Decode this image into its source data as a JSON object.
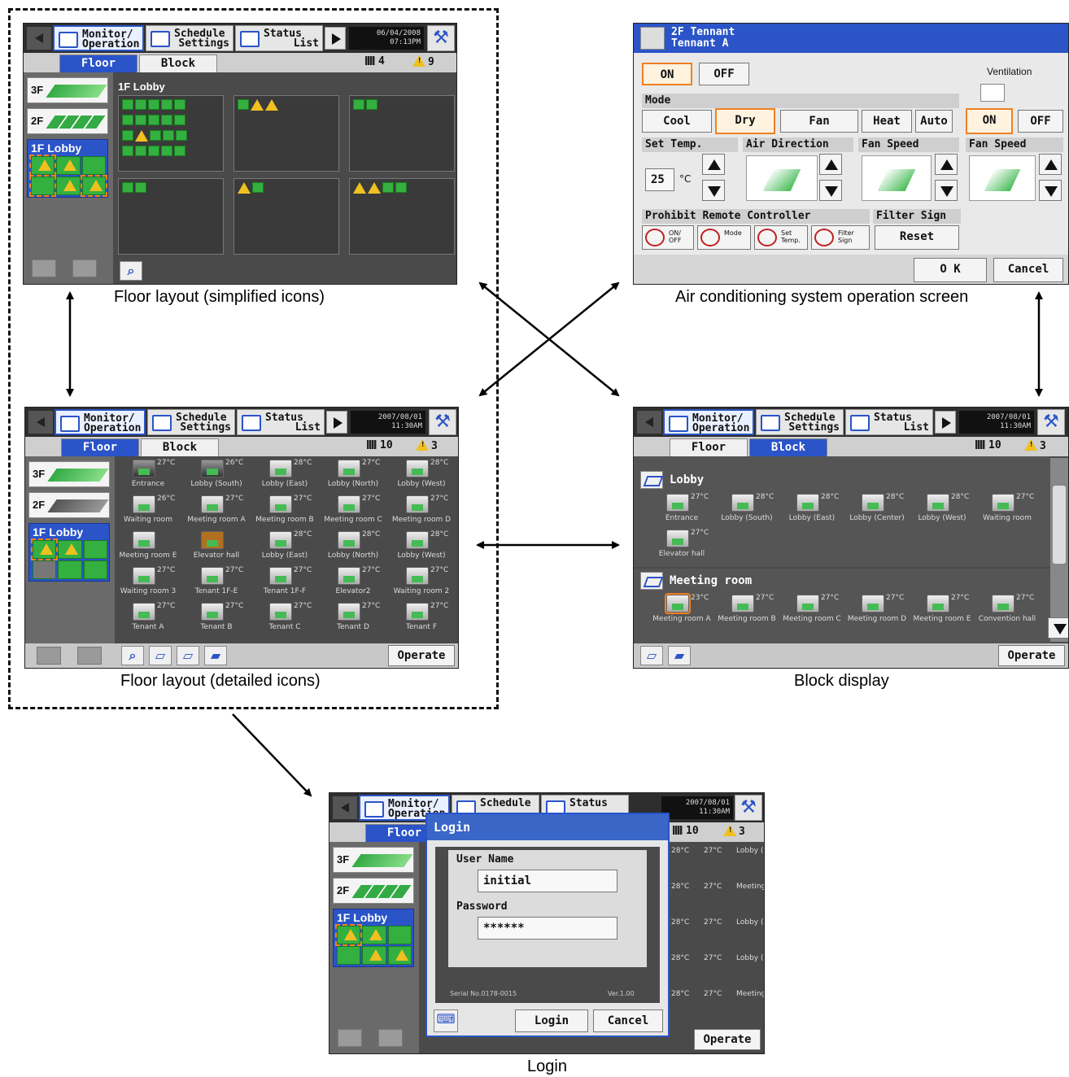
{
  "captions": {
    "simplified": "Floor layout (simplified icons)",
    "operation": "Air conditioning system operation screen",
    "detailed": "Floor layout (detailed icons)",
    "block": "Block display",
    "login": "Login"
  },
  "tabs": {
    "monitor_l1": "Monitor/",
    "monitor_l2": "Operation",
    "schedule_l1": "Schedule",
    "schedule_l2": "Settings",
    "status_l1": "Status",
    "status_l2": "List"
  },
  "subtabs": {
    "floor": "Floor",
    "block": "Block"
  },
  "floors": {
    "f3": "3F",
    "f2": "2F",
    "f1": "1F Lobby"
  },
  "operate_label": "Operate",
  "screen1": {
    "date": "06/04/2008",
    "time": "07:13PM",
    "unit_count": "4",
    "warn_count": "9",
    "area_title": "1F Lobby"
  },
  "screen3": {
    "date": "2007/08/01",
    "time": "11:30AM",
    "unit_count": "10",
    "warn_count": "3",
    "units": [
      {
        "name": "Entrance",
        "temp": "27°C"
      },
      {
        "name": "Lobby (South)",
        "temp": "26°C"
      },
      {
        "name": "Lobby (East)",
        "temp": "28°C"
      },
      {
        "name": "Lobby (North)",
        "temp": "27°C"
      },
      {
        "name": "Lobby (West)",
        "temp": "28°C"
      },
      {
        "name": "Waiting room",
        "temp": "26°C"
      },
      {
        "name": "Meeting room A",
        "temp": "27°C"
      },
      {
        "name": "Meeting room B",
        "temp": "27°C"
      },
      {
        "name": "Meeting room C",
        "temp": "27°C"
      },
      {
        "name": "Meeting room D",
        "temp": "27°C"
      },
      {
        "name": "Meeting room E",
        "temp": ""
      },
      {
        "name": "Elevator hall",
        "temp": ""
      },
      {
        "name": "Lobby (East)",
        "temp": "28°C"
      },
      {
        "name": "Lobby (North)",
        "temp": "28°C"
      },
      {
        "name": "Lobby (West)",
        "temp": "28°C"
      },
      {
        "name": "Waiting room 3",
        "temp": "27°C"
      },
      {
        "name": "Tenant 1F-E",
        "temp": "27°C"
      },
      {
        "name": "Tenant 1F-F",
        "temp": "27°C"
      },
      {
        "name": "Elevator2",
        "temp": "27°C"
      },
      {
        "name": "Waiting room 2",
        "temp": "27°C"
      },
      {
        "name": "Tenant A",
        "temp": "27°C"
      },
      {
        "name": "Tenant B",
        "temp": "27°C"
      },
      {
        "name": "Tenant C",
        "temp": "27°C"
      },
      {
        "name": "Tenant D",
        "temp": "27°C"
      },
      {
        "name": "Tenant F",
        "temp": "27°C"
      }
    ]
  },
  "screen4": {
    "date": "2007/08/01",
    "time": "11:30AM",
    "unit_count": "10",
    "warn_count": "3",
    "group1": "Lobby",
    "group1_units": [
      {
        "name": "Entrance",
        "temp": "27°C"
      },
      {
        "name": "Lobby (South)",
        "temp": "28°C"
      },
      {
        "name": "Lobby (East)",
        "temp": "28°C"
      },
      {
        "name": "Lobby (Center)",
        "temp": "28°C"
      },
      {
        "name": "Lobby (West)",
        "temp": "28°C"
      },
      {
        "name": "Waiting room",
        "temp": "27°C"
      },
      {
        "name": "Elevator hall",
        "temp": "27°C"
      }
    ],
    "group2": "Meeting room",
    "group2_units": [
      {
        "name": "Meeting room A",
        "temp": "23°C"
      },
      {
        "name": "Meeting room B",
        "temp": "27°C"
      },
      {
        "name": "Meeting room C",
        "temp": "27°C"
      },
      {
        "name": "Meeting room D",
        "temp": "27°C"
      },
      {
        "name": "Meeting room E",
        "temp": "27°C"
      },
      {
        "name": "Convention hall",
        "temp": "27°C"
      }
    ]
  },
  "screen2": {
    "title_l1": "2F Tennant",
    "title_l2": "Tennant A",
    "on": "ON",
    "off": "OFF",
    "ventilation": "Ventilation",
    "mode": "Mode",
    "modes": [
      "Cool",
      "Dry",
      "Fan",
      "Heat",
      "Auto"
    ],
    "set_temp": "Set Temp.",
    "temp_value": "25",
    "temp_unit": "°C",
    "air_direction": "Air Direction",
    "fan_speed": "Fan Speed",
    "prohibit": "Prohibit Remote Controller",
    "filter_sign": "Filter Sign",
    "prohibit_btns": [
      "ON/ OFF",
      "Mode",
      "Set Temp.",
      "Filter Sign"
    ],
    "reset": "Reset",
    "ok": "O K",
    "cancel": "Cancel"
  },
  "screen5": {
    "date": "2007/08/01",
    "time": "11:30AM",
    "unit_count": "10",
    "warn_count": "3",
    "dialog_title": "Login",
    "user_label": "User Name",
    "user_value": "initial",
    "password_label": "Password",
    "password_value": "******",
    "serial": "Serial No.0178-0015",
    "version": "Ver.1.00",
    "login_btn": "Login",
    "cancel_btn": "Cancel",
    "bg_units": [
      "28°C",
      "27°C",
      "Lobby (West)",
      "28°C",
      "27°C",
      "Meeting room D",
      "28°C",
      "27°C",
      "Lobby (West)",
      "28°C",
      "27°C",
      "Lobby (West)",
      "28°C",
      "27°C",
      "Meeting room D"
    ]
  }
}
